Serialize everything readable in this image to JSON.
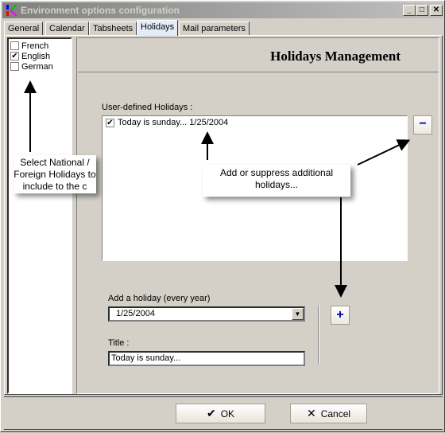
{
  "window": {
    "title": "Environment options configuration",
    "controls": {
      "minimize": "_",
      "maximize": "□",
      "close": "✕"
    }
  },
  "tabs": [
    {
      "label": "General",
      "active": false
    },
    {
      "label": "Calendar",
      "active": false
    },
    {
      "label": "Tabsheets",
      "active": false
    },
    {
      "label": "Holidays",
      "active": true
    },
    {
      "label": "Mail parameters",
      "active": false
    }
  ],
  "national_holidays": [
    {
      "label": "French",
      "checked": false
    },
    {
      "label": "English",
      "checked": true
    },
    {
      "label": "German",
      "checked": false
    }
  ],
  "panel": {
    "title": "Holidays Management",
    "user_defined_label": "User-defined Holidays :",
    "user_defined_items": [
      {
        "label": "Today is sunday... 1/25/2004",
        "checked": true
      }
    ],
    "remove_button": "−",
    "add_button": "+",
    "add_holiday_label": "Add a holiday (every year)",
    "add_holiday_value": "1/25/2004",
    "title_label": "Title :",
    "title_value": "Today is sunday..."
  },
  "callouts": {
    "left": "Select National / Foreign Holidays to include to the c",
    "right": "Add or suppress additional holidays..."
  },
  "footer": {
    "ok_label": "OK",
    "cancel_label": "Cancel"
  },
  "colors": {
    "face": "#d4d0c8",
    "active_tab": "#e3ecf8",
    "button_glyph": "#0000a0"
  }
}
